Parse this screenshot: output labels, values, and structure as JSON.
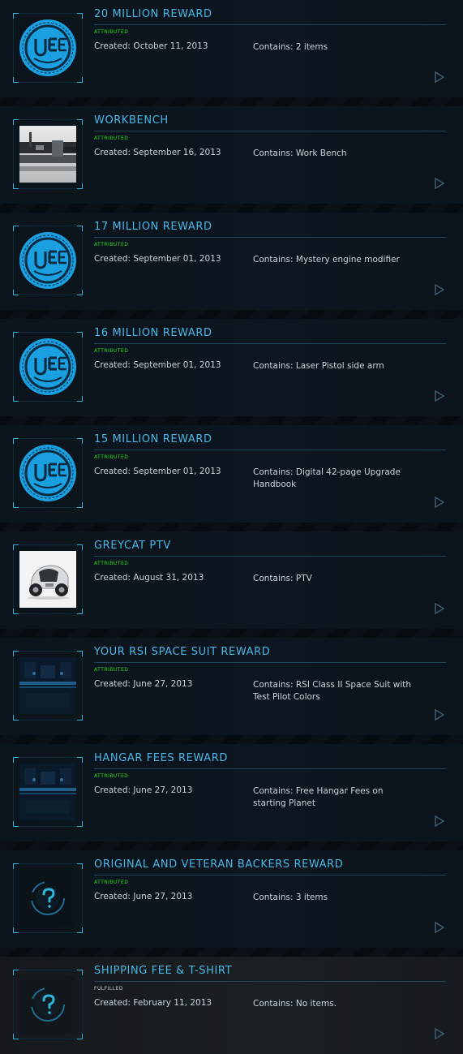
{
  "pledges": [
    {
      "title": "20 MILLION REWARD",
      "status": "ATTRIBUTED",
      "created": "Created: October 11, 2013",
      "contains": "Contains: 2 items",
      "thumb": "uee-logo-icon"
    },
    {
      "title": "WORKBENCH",
      "status": "ATTRIBUTED",
      "created": "Created: September 16, 2013",
      "contains": "Contains: Work Bench",
      "thumb": "workbench-photo"
    },
    {
      "title": "17 MILLION REWARD",
      "status": "ATTRIBUTED",
      "created": "Created: September 01, 2013",
      "contains": "Contains: Mystery engine modifier",
      "thumb": "uee-logo-icon"
    },
    {
      "title": "16 MILLION REWARD",
      "status": "ATTRIBUTED",
      "created": "Created: September 01, 2013",
      "contains": "Contains: Laser Pistol side arm",
      "thumb": "uee-logo-icon"
    },
    {
      "title": "15 MILLION REWARD",
      "status": "ATTRIBUTED",
      "created": "Created: September 01, 2013",
      "contains": "Contains: Digital 42-page Upgrade Handbook",
      "thumb": "uee-logo-icon"
    },
    {
      "title": "GREYCAT PTV",
      "status": "ATTRIBUTED",
      "created": "Created: August 31, 2013",
      "contains": "Contains: PTV",
      "thumb": "greycat-ptv-photo"
    },
    {
      "title": "YOUR RSI SPACE SUIT REWARD",
      "status": "ATTRIBUTED",
      "created": "Created: June 27, 2013",
      "contains": "Contains: RSI Class II Space Suit with Test Pilot Colors",
      "thumb": "hangar-interior-photo"
    },
    {
      "title": "HANGAR FEES REWARD",
      "status": "ATTRIBUTED",
      "created": "Created: June 27, 2013",
      "contains": "Contains: Free Hangar Fees on starting Planet",
      "thumb": "hangar-interior-photo"
    },
    {
      "title": "ORIGINAL AND VETERAN BACKERS REWARD",
      "status": "ATTRIBUTED",
      "created": "Created: June 27, 2013",
      "contains": "Contains: 3 items",
      "thumb": "question-mark-icon"
    },
    {
      "title": "SHIPPING FEE & T-SHIRT",
      "status": "FULFILLED",
      "created": "Created: February 11, 2013",
      "contains": "Contains: No items.",
      "thumb": "question-mark-icon"
    }
  ],
  "colors": {
    "accent": "#49b7e4",
    "attributed": "#2ee01a",
    "uee_blue": "#1a9fe0"
  }
}
